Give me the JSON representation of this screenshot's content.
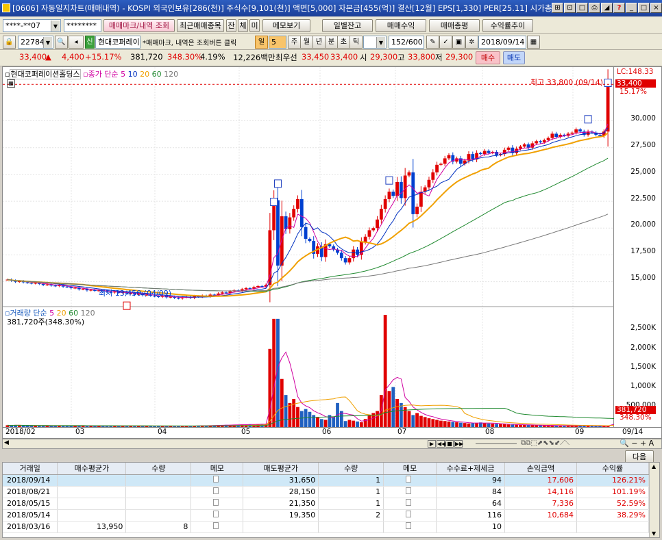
{
  "window": {
    "title": "[0606] 자동일지차트(매매내역) - KOSPI 외국인보유[286(천)] 주식수[9,101(천)] 액면[5,000] 자본금[455(억)] 결산[12월] EPS[1,330] PER[25.11] 시가총"
  },
  "toolbar1": {
    "account": "****-**07",
    "password": "********",
    "mark_btn": "매매마크/내역 조회",
    "recent_btn": "최근매매종목",
    "jan": "잔",
    "che": "체",
    "mi": "미",
    "memo_btn": "메모보기",
    "daily_btn": "일별잔고",
    "profit_btn": "매매수익",
    "total_btn": "매매총평",
    "trend_btn": "수익률추이"
  },
  "toolbar2": {
    "code": "227840",
    "sin": "신",
    "name": "현대코퍼레이",
    "hint": "*매매마크, 내역은 조회버튼 클릭",
    "periods": [
      "일",
      "5",
      "주",
      "월",
      "년",
      "분",
      "초",
      "틱"
    ],
    "count": "152",
    "count_total": "/600",
    "date": "2018/09/14"
  },
  "quote": {
    "price": "33,400",
    "arrow": "▲",
    "change": "4,400",
    "pct": "+15.17%",
    "volume": "381,720",
    "vol_pct": "348.30%",
    "turnover_pct": "4.19%",
    "amount": "12,226백만",
    "best_label": "최우선",
    "best_ask": "33,450",
    "best_bid": "33,400",
    "open_label": "시",
    "open": "29,300",
    "high_label": "고",
    "high": "33,800",
    "low_label": "저",
    "low": "29,300",
    "buy": "매수",
    "sell": "매도"
  },
  "chart": {
    "stock_name": "현대코퍼레이션홀딩스",
    "ma_label": "종가 단순",
    "ma_periods": [
      "5",
      "10",
      "20",
      "60",
      "120"
    ],
    "lc": "LC:148.33",
    "last_price_tag": "33,400",
    "last_pct_tag": "15.17%",
    "high_note": "최고 33,800 (09/14)",
    "low_note": "최저 13,450 (04/09)"
  },
  "volume_panel": {
    "title": "거래량 단순",
    "periods": [
      "5",
      "20",
      "60",
      "120"
    ],
    "value": "381,720주(348.30%)",
    "tag_value": "381,720",
    "tag_pct": "348.30%"
  },
  "price_axis": [
    "30,000",
    "27,500",
    "25,000",
    "22,500",
    "20,000",
    "17,500",
    "15,000"
  ],
  "volume_axis": [
    "2,500K",
    "2,000K",
    "1,500K",
    "1,000K",
    "500,000"
  ],
  "x_axis": [
    "2018/02",
    "03",
    "04",
    "05",
    "06",
    "07",
    "08",
    "09",
    "09/14"
  ],
  "next_btn": "다음",
  "table": {
    "headers": [
      "거래일",
      "매수평균가",
      "수량",
      "메모",
      "매도평균가",
      "수량",
      "메모",
      "수수료+제세금",
      "손익금액",
      "수익률"
    ],
    "rows": [
      [
        "2018/09/14",
        "",
        "",
        "",
        "31,650",
        "1",
        "",
        "94",
        "17,606",
        "126.21%"
      ],
      [
        "2018/08/21",
        "",
        "",
        "",
        "28,150",
        "1",
        "",
        "84",
        "14,116",
        "101.19%"
      ],
      [
        "2018/05/15",
        "",
        "",
        "",
        "21,350",
        "1",
        "",
        "64",
        "7,336",
        "52.59%"
      ],
      [
        "2018/05/14",
        "",
        "",
        "",
        "19,350",
        "2",
        "",
        "116",
        "10,684",
        "38.29%"
      ],
      [
        "2018/03/16",
        "13,950",
        "8",
        "",
        "",
        "",
        "",
        "10",
        "",
        ""
      ]
    ]
  },
  "chart_data": {
    "type": "candlestick",
    "price_range": [
      13000,
      34500
    ],
    "volume_range": [
      0,
      2800000
    ],
    "x_labels": [
      "2018/02",
      "03",
      "04",
      "05",
      "06",
      "07",
      "08",
      "09",
      "09/14"
    ],
    "closes": [
      15200,
      15100,
      15000,
      15050,
      14950,
      14900,
      14850,
      14900,
      14800,
      14700,
      14750,
      14650,
      14600,
      14700,
      14550,
      14500,
      14400,
      14450,
      14300,
      14350,
      14200,
      14250,
      14150,
      14200,
      14100,
      14050,
      14000,
      14100,
      13950,
      14050,
      13900,
      13950,
      13800,
      13900,
      13750,
      13800,
      13700,
      13650,
      13600,
      13700,
      13550,
      13600,
      13500,
      13450,
      13550,
      13600,
      13500,
      13650,
      13600,
      13700,
      13650,
      13800,
      13750,
      13900,
      14000,
      13950,
      14100,
      14200,
      14150,
      14300,
      14400,
      14350,
      14500,
      14600,
      14550,
      14700,
      19800,
      22600,
      16500,
      21100,
      19900,
      21000,
      21800,
      22700,
      20100,
      19000,
      18800,
      17600,
      18300,
      17300,
      18500,
      18300,
      18000,
      17700,
      17200,
      16800,
      17200,
      18000,
      17500,
      18700,
      19200,
      19800,
      20000,
      20800,
      21800,
      22700,
      23400,
      23000,
      24300,
      22800,
      24900,
      25200,
      21300,
      22000,
      23400,
      23800,
      24500,
      25200,
      25900,
      26000,
      26500,
      26800,
      26200,
      26500,
      26000,
      26300,
      26900,
      26400,
      27000,
      26900,
      27200,
      27000,
      27100,
      26800,
      26900,
      27300,
      27500,
      27000,
      27400,
      27600,
      27800,
      27500,
      27900,
      28100,
      28000,
      28200,
      28400,
      28800,
      28500,
      28700,
      28600,
      28800,
      28900,
      29200,
      29000,
      28700,
      29000,
      28900,
      28700,
      28600,
      29000,
      33400
    ],
    "volumes_k": [
      45,
      38,
      52,
      40,
      36,
      42,
      30,
      28,
      35,
      33,
      31,
      29,
      37,
      34,
      40,
      32,
      30,
      28,
      35,
      33,
      26,
      29,
      31,
      27,
      30,
      25,
      28,
      32,
      26,
      24,
      27,
      30,
      25,
      22,
      29,
      26,
      24,
      28,
      21,
      23,
      25,
      27,
      22,
      20,
      24,
      26,
      30,
      28,
      35,
      40,
      38,
      42,
      45,
      50,
      48,
      55,
      52,
      60,
      58,
      65,
      62,
      70,
      68,
      75,
      80,
      78,
      1950,
      2700,
      2700,
      1200,
      800,
      600,
      700,
      500,
      400,
      450,
      380,
      300,
      250,
      200,
      180,
      300,
      250,
      600,
      400,
      150,
      180,
      160,
      140,
      120,
      200,
      300,
      350,
      400,
      800,
      2800,
      900,
      1000,
      700,
      600,
      500,
      400,
      300,
      350,
      280,
      250,
      220,
      200,
      180,
      160,
      150,
      140,
      130,
      120,
      110,
      100,
      90,
      95,
      105,
      115,
      100,
      90,
      85,
      80,
      75,
      70,
      65,
      60,
      58,
      55,
      52,
      50,
      48,
      45,
      42,
      40,
      38,
      36,
      34,
      32,
      30,
      35,
      40,
      38,
      36,
      34,
      32,
      30,
      28,
      26,
      24,
      22,
      180,
      130,
      381
    ]
  }
}
